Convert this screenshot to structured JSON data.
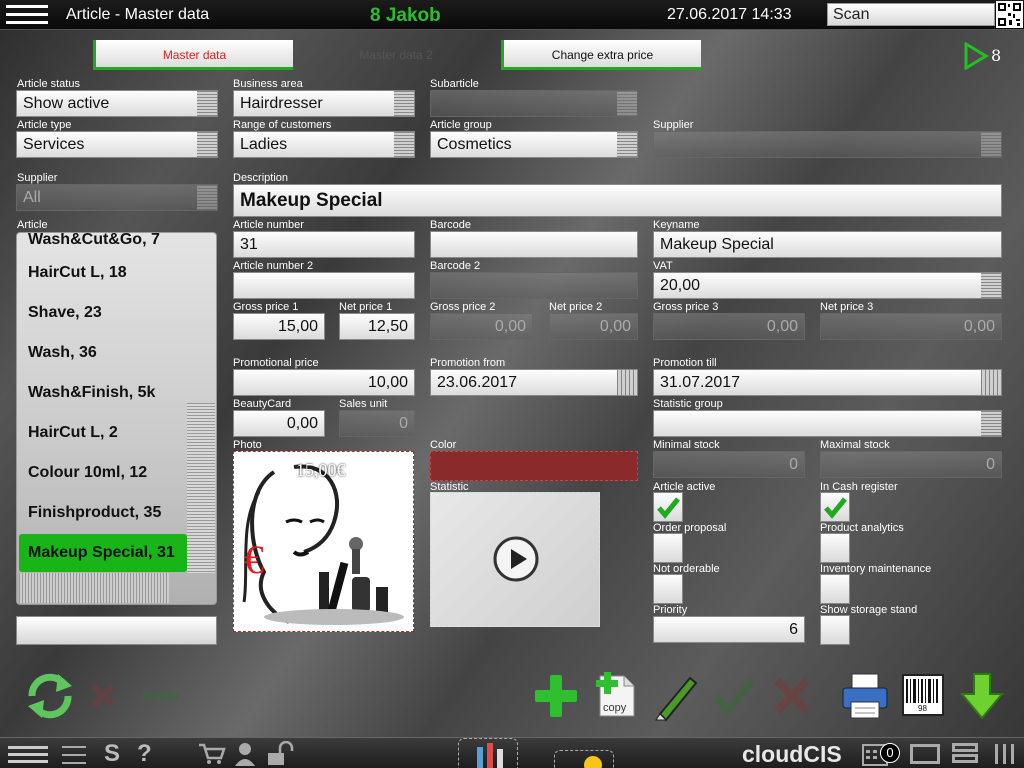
{
  "header": {
    "title": "Article - Master data",
    "user": "8 Jakob",
    "datetime": "27.06.2017 14:33",
    "scan_value": "Scan"
  },
  "tabs": [
    {
      "label": "Master data",
      "active": true
    },
    {
      "label": "Master data 2",
      "active": false
    },
    {
      "label": "Change extra price",
      "active": false
    }
  ],
  "nav": {
    "counter": "8"
  },
  "fields": {
    "article_status": {
      "label": "Article status",
      "value": "Show active"
    },
    "business_area": {
      "label": "Business area",
      "value": "Hairdresser"
    },
    "subarticle": {
      "label": "Subarticle",
      "value": ""
    },
    "article_type": {
      "label": "Article type",
      "value": "Services"
    },
    "range_customers": {
      "label": "Range of customers",
      "value": "Ladies"
    },
    "article_group": {
      "label": "Article group",
      "value": "Cosmetics"
    },
    "supplier_top": {
      "label": "Supplier",
      "value": ""
    },
    "supplier": {
      "label": "Supplier",
      "value": "All"
    },
    "description": {
      "label": "Description",
      "value": "Makeup Special"
    },
    "article": {
      "label": "Article"
    },
    "article_number": {
      "label": "Article number",
      "value": "31"
    },
    "barcode": {
      "label": "Barcode",
      "value": ""
    },
    "keyname": {
      "label": "Keyname",
      "value": "Makeup Special"
    },
    "article_number2": {
      "label": "Article number 2",
      "value": ""
    },
    "barcode2": {
      "label": "Barcode 2",
      "value": ""
    },
    "vat": {
      "label": "VAT",
      "value": "20,00"
    },
    "gross1": {
      "label": "Gross price 1",
      "value": "15,00"
    },
    "net1": {
      "label": "Net price 1",
      "value": "12,50"
    },
    "gross2": {
      "label": "Gross price 2",
      "value": "0,00"
    },
    "net2": {
      "label": "Net price 2",
      "value": "0,00"
    },
    "gross3": {
      "label": "Gross price 3",
      "value": "0,00"
    },
    "net3": {
      "label": "Net price 3",
      "value": "0,00"
    },
    "promo_price": {
      "label": "Promotional price",
      "value": "10,00"
    },
    "promo_from": {
      "label": "Promotion from",
      "value": "23.06.2017"
    },
    "promo_till": {
      "label": "Promotion till",
      "value": "31.07.2017"
    },
    "beautycard": {
      "label": "BeautyCard",
      "value": "0,00"
    },
    "sales_unit": {
      "label": "Sales unit",
      "value": "0"
    },
    "statistic_group": {
      "label": "Statistic group",
      "value": ""
    },
    "photo": {
      "label": "Photo",
      "price_overlay": "15,00€"
    },
    "color": {
      "label": "Color",
      "value": "#8b2a2a"
    },
    "statistic": {
      "label": "Statistic"
    },
    "min_stock": {
      "label": "Minimal stock",
      "value": "0"
    },
    "max_stock": {
      "label": "Maximal stock",
      "value": "0"
    },
    "priority": {
      "label": "Priority",
      "value": "6"
    }
  },
  "checkboxes": [
    {
      "label": "Article active",
      "checked": true
    },
    {
      "label": "In Cash register",
      "checked": true
    },
    {
      "label": "Order proposal",
      "checked": false
    },
    {
      "label": "Product analytics",
      "checked": false
    },
    {
      "label": "Not orderable",
      "checked": false
    },
    {
      "label": "Inventory maintenance",
      "checked": false
    },
    {
      "label": "Show storage stand",
      "checked": false
    }
  ],
  "article_list": [
    {
      "label": "Wash&Cut&Go, 7",
      "selected": false
    },
    {
      "label": "HairCut L, 18",
      "selected": false
    },
    {
      "label": "Shave, 23",
      "selected": false
    },
    {
      "label": "Wash, 36",
      "selected": false
    },
    {
      "label": "Wash&Finish, 5k",
      "selected": false
    },
    {
      "label": "HairCut L, 2",
      "selected": false
    },
    {
      "label": "Colour 10ml, 12",
      "selected": false
    },
    {
      "label": "Finishproduct, 35",
      "selected": false
    },
    {
      "label": "Makeup Special, 31",
      "selected": true
    }
  ],
  "toolbar": {
    "copy_label": "copy",
    "barcode_digits": "98"
  },
  "footer": {
    "brand": "cloudCIS",
    "badge": "0"
  },
  "colors": {
    "accent_green": "#23a823",
    "active_tab_text": "#e02020",
    "user_green": "#2ac02a"
  },
  "icons": [
    "menu-icon",
    "qr-code-icon",
    "play-next-icon",
    "refresh-icon",
    "add-icon",
    "copy-icon",
    "edit-pen-icon",
    "confirm-icon",
    "cancel-icon",
    "printer-icon",
    "barcode-icon",
    "save-download-icon",
    "cart-icon",
    "user-icon",
    "lock-icon",
    "calendar-icon",
    "window-icon",
    "split-view-icon",
    "columns-icon"
  ]
}
